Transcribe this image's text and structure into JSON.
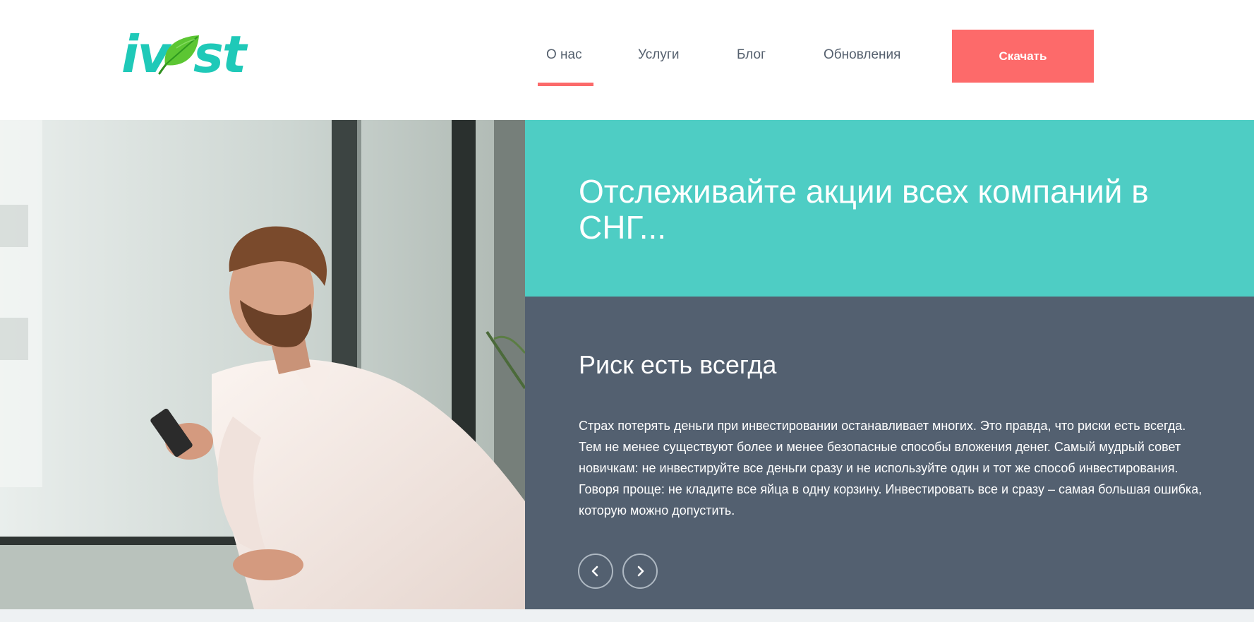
{
  "brand": {
    "logo_text_left": "iv",
    "logo_text_right": "st",
    "logo_color": "#1fc9b8",
    "leaf_color": "#5cc633"
  },
  "nav": {
    "items": [
      {
        "label": "О нас",
        "active": true
      },
      {
        "label": "Услуги",
        "active": false
      },
      {
        "label": "Блог",
        "active": false
      },
      {
        "label": "Обновления",
        "active": false
      }
    ],
    "active_indicator_color": "#fb6a6a",
    "download_label": "Скачать",
    "download_color": "#fd6a6a"
  },
  "hero": {
    "title": "Отслеживайте акции всех компаний в СНГ...",
    "accent_color": "#4ecdc4"
  },
  "info": {
    "title": "Риск есть всегда",
    "text": "Страх потерять деньги при инвестировании останавливает многих. Это правда, что риски есть всегда. Тем не менее существуют более и менее безопасные способы вложения денег. Самый мудрый совет новичкам: не инвестируйте все деньги сразу и не используйте один и тот же способ инвестирования. Говоря проще: не кладите все яйца в одну корзину. Инвестировать все и сразу – самая большая ошибка, которую можно допустить.",
    "background_color": "#536070",
    "prev_icon": "chevron-left-icon",
    "next_icon": "chevron-right-icon"
  },
  "photo": {
    "subject": "man-looking-at-phone-by-window"
  }
}
